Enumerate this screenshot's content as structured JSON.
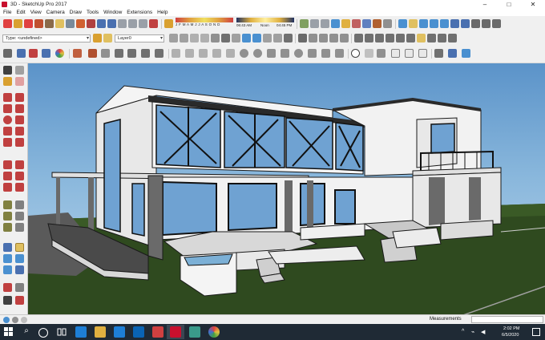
{
  "window": {
    "title": "3D - SketchUp Pro 2017",
    "minimize": "–",
    "maximize": "□",
    "close": "✕"
  },
  "menu": [
    "File",
    "Edit",
    "View",
    "Camera",
    "Draw",
    "Tools",
    "Window",
    "Extensions",
    "Help"
  ],
  "shadow_panel": {
    "months": "J F M A M J J A S O N D",
    "time_start": "06:43 AM",
    "time_noon": "Noon",
    "time_end": "04:45 PM"
  },
  "toolbar": {
    "style_select": "Type: <undefined>",
    "layer_select": "Layer0"
  },
  "status": {
    "measurements_label": "Measurements",
    "measurements_value": ""
  },
  "taskbar": {
    "time": "2:02 PM",
    "date": "6/5/2020"
  },
  "colors": {
    "sky_top": "#5b93c9",
    "ground": "#2f4a1f",
    "accent": "#c8102e"
  }
}
